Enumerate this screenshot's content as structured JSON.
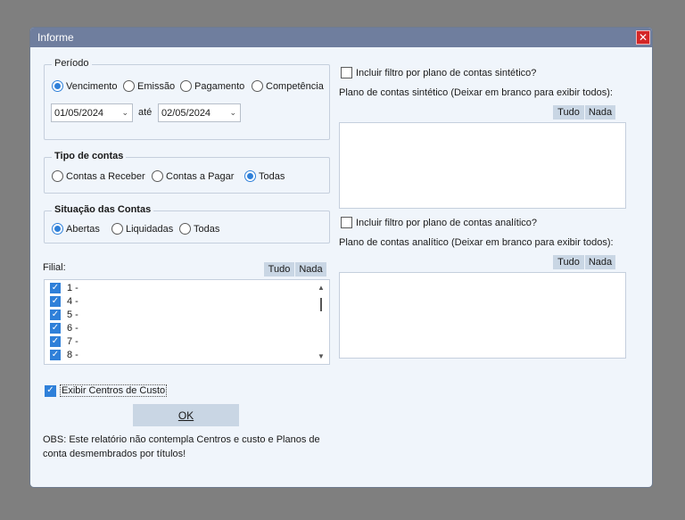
{
  "window": {
    "title": "Informe",
    "close_icon": "close-icon"
  },
  "periodo": {
    "legend": "Período",
    "options": [
      "Vencimento",
      "Emissão",
      "Pagamento",
      "Competência"
    ],
    "selected": "Vencimento",
    "date_from": "01/05/2024",
    "date_sep": "até",
    "date_to": "02/05/2024"
  },
  "tipo_contas": {
    "legend": "Tipo de contas",
    "options": [
      "Contas a Receber",
      "Contas a Pagar",
      "Todas"
    ],
    "selected": "Todas"
  },
  "situacao": {
    "legend": "Situação das Contas",
    "options": [
      "Abertas",
      "Liquidadas",
      "Todas"
    ],
    "selected": "Abertas"
  },
  "filial": {
    "label": "Filial:",
    "tudo": "Tudo",
    "nada": "Nada",
    "items": [
      "1 -",
      "4 -",
      "5 -",
      "6 -",
      "7 -",
      "8 -"
    ]
  },
  "centros": {
    "label": "Exibir Centros de Custo",
    "checked": true
  },
  "ok_label": "OK",
  "obs": [
    "OBS: Este relatório não contempla Centros e custo e Planos de",
    "conta desmembrados por títulos!"
  ],
  "sintetico": {
    "check_label": "Incluir filtro por plano de contas sintético?",
    "desc": "Plano de contas sintético (Deixar em branco para exibir todos):",
    "tudo": "Tudo",
    "nada": "Nada"
  },
  "analitico": {
    "check_label": "Incluir filtro por plano de contas analítico?",
    "desc": "Plano de contas analítico (Deixar em branco para exibir todos):",
    "tudo": "Tudo",
    "nada": "Nada"
  },
  "colors": {
    "accent": "#2f80d9",
    "titlebar": "#6f7e9e",
    "close": "#d42626"
  }
}
